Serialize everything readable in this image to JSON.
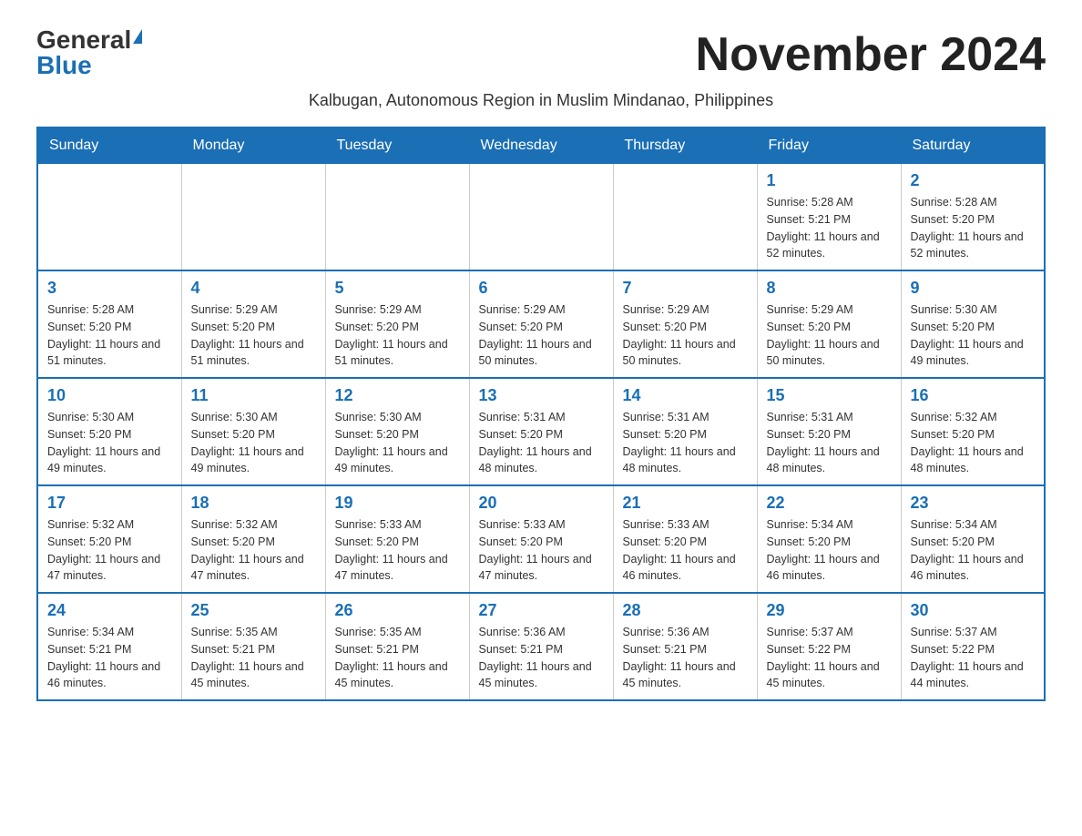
{
  "logo": {
    "general": "General",
    "blue": "Blue"
  },
  "title": "November 2024",
  "subtitle": "Kalbugan, Autonomous Region in Muslim Mindanao, Philippines",
  "days_of_week": [
    "Sunday",
    "Monday",
    "Tuesday",
    "Wednesday",
    "Thursday",
    "Friday",
    "Saturday"
  ],
  "weeks": [
    [
      {
        "day": "",
        "info": ""
      },
      {
        "day": "",
        "info": ""
      },
      {
        "day": "",
        "info": ""
      },
      {
        "day": "",
        "info": ""
      },
      {
        "day": "",
        "info": ""
      },
      {
        "day": "1",
        "info": "Sunrise: 5:28 AM\nSunset: 5:21 PM\nDaylight: 11 hours and 52 minutes."
      },
      {
        "day": "2",
        "info": "Sunrise: 5:28 AM\nSunset: 5:20 PM\nDaylight: 11 hours and 52 minutes."
      }
    ],
    [
      {
        "day": "3",
        "info": "Sunrise: 5:28 AM\nSunset: 5:20 PM\nDaylight: 11 hours and 51 minutes."
      },
      {
        "day": "4",
        "info": "Sunrise: 5:29 AM\nSunset: 5:20 PM\nDaylight: 11 hours and 51 minutes."
      },
      {
        "day": "5",
        "info": "Sunrise: 5:29 AM\nSunset: 5:20 PM\nDaylight: 11 hours and 51 minutes."
      },
      {
        "day": "6",
        "info": "Sunrise: 5:29 AM\nSunset: 5:20 PM\nDaylight: 11 hours and 50 minutes."
      },
      {
        "day": "7",
        "info": "Sunrise: 5:29 AM\nSunset: 5:20 PM\nDaylight: 11 hours and 50 minutes."
      },
      {
        "day": "8",
        "info": "Sunrise: 5:29 AM\nSunset: 5:20 PM\nDaylight: 11 hours and 50 minutes."
      },
      {
        "day": "9",
        "info": "Sunrise: 5:30 AM\nSunset: 5:20 PM\nDaylight: 11 hours and 49 minutes."
      }
    ],
    [
      {
        "day": "10",
        "info": "Sunrise: 5:30 AM\nSunset: 5:20 PM\nDaylight: 11 hours and 49 minutes."
      },
      {
        "day": "11",
        "info": "Sunrise: 5:30 AM\nSunset: 5:20 PM\nDaylight: 11 hours and 49 minutes."
      },
      {
        "day": "12",
        "info": "Sunrise: 5:30 AM\nSunset: 5:20 PM\nDaylight: 11 hours and 49 minutes."
      },
      {
        "day": "13",
        "info": "Sunrise: 5:31 AM\nSunset: 5:20 PM\nDaylight: 11 hours and 48 minutes."
      },
      {
        "day": "14",
        "info": "Sunrise: 5:31 AM\nSunset: 5:20 PM\nDaylight: 11 hours and 48 minutes."
      },
      {
        "day": "15",
        "info": "Sunrise: 5:31 AM\nSunset: 5:20 PM\nDaylight: 11 hours and 48 minutes."
      },
      {
        "day": "16",
        "info": "Sunrise: 5:32 AM\nSunset: 5:20 PM\nDaylight: 11 hours and 48 minutes."
      }
    ],
    [
      {
        "day": "17",
        "info": "Sunrise: 5:32 AM\nSunset: 5:20 PM\nDaylight: 11 hours and 47 minutes."
      },
      {
        "day": "18",
        "info": "Sunrise: 5:32 AM\nSunset: 5:20 PM\nDaylight: 11 hours and 47 minutes."
      },
      {
        "day": "19",
        "info": "Sunrise: 5:33 AM\nSunset: 5:20 PM\nDaylight: 11 hours and 47 minutes."
      },
      {
        "day": "20",
        "info": "Sunrise: 5:33 AM\nSunset: 5:20 PM\nDaylight: 11 hours and 47 minutes."
      },
      {
        "day": "21",
        "info": "Sunrise: 5:33 AM\nSunset: 5:20 PM\nDaylight: 11 hours and 46 minutes."
      },
      {
        "day": "22",
        "info": "Sunrise: 5:34 AM\nSunset: 5:20 PM\nDaylight: 11 hours and 46 minutes."
      },
      {
        "day": "23",
        "info": "Sunrise: 5:34 AM\nSunset: 5:20 PM\nDaylight: 11 hours and 46 minutes."
      }
    ],
    [
      {
        "day": "24",
        "info": "Sunrise: 5:34 AM\nSunset: 5:21 PM\nDaylight: 11 hours and 46 minutes."
      },
      {
        "day": "25",
        "info": "Sunrise: 5:35 AM\nSunset: 5:21 PM\nDaylight: 11 hours and 45 minutes."
      },
      {
        "day": "26",
        "info": "Sunrise: 5:35 AM\nSunset: 5:21 PM\nDaylight: 11 hours and 45 minutes."
      },
      {
        "day": "27",
        "info": "Sunrise: 5:36 AM\nSunset: 5:21 PM\nDaylight: 11 hours and 45 minutes."
      },
      {
        "day": "28",
        "info": "Sunrise: 5:36 AM\nSunset: 5:21 PM\nDaylight: 11 hours and 45 minutes."
      },
      {
        "day": "29",
        "info": "Sunrise: 5:37 AM\nSunset: 5:22 PM\nDaylight: 11 hours and 45 minutes."
      },
      {
        "day": "30",
        "info": "Sunrise: 5:37 AM\nSunset: 5:22 PM\nDaylight: 11 hours and 44 minutes."
      }
    ]
  ]
}
